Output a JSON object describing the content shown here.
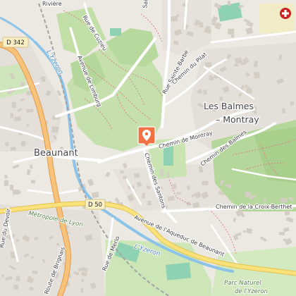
{
  "map": {
    "colors": {
      "land": "#ece9e3",
      "urban": "#e3dfd8",
      "building": "#d6cfc6",
      "park": "#c9e3b2",
      "forest": "#b2d49a",
      "sport_pitch": "#8fd1b3",
      "water": "#8cc3e8",
      "highway": "#f2b56e",
      "highway_casing": "#e49a4a",
      "minor_road": "#ffffff",
      "rail": "#9e9e9e",
      "path": "#d98585",
      "marker": "#f07143",
      "hospital_badge": "#cc2222"
    },
    "road_labels": {
      "d342": "D 342",
      "d50": "D 50",
      "avenue_limburg": "Avenue de Limburg",
      "rue_de_cuzieu": "Rue de Cuzieu",
      "rue_saint_barbe": "Rue Sainte-Barbe",
      "chemin_du_pilat": "Chemin du Pilat",
      "chemin_de_montray": "Chemin de Montray",
      "chemin_des_balmes": "Chemin des Balmes",
      "chemin_des_santons": "Chemin des Santons",
      "chemin_croix_berthet": "Chemin de la Croix-Berthet",
      "avenue_aqueduc": "Avenue de l'Aqueduc de Beaunant",
      "route_de_brignais": "Route de Brignais",
      "rue_du_devoir": "Rue du Devoir",
      "rue_de_merlo": "Rue de Merlo",
      "riviere": "Rivière",
      "sainte_fragment": "Sainte"
    },
    "place_labels": {
      "beaunant": "Beaunant",
      "les_balmes_line1": "Les Balmes",
      "les_balmes_line2": "– Montray"
    },
    "water_labels": {
      "yzeron_north": "L'Yzeron",
      "yzeron_south": "L'Yzeron"
    },
    "area_labels": {
      "metropole_lyon": "Métropole de Lyon",
      "parc_naturel_line1": "Parc Naturel",
      "parc_naturel_line2": "de l'Yzeron"
    },
    "icons": {
      "location_marker": "location-pin-icon",
      "hospital": "hospital-cross-icon"
    }
  }
}
